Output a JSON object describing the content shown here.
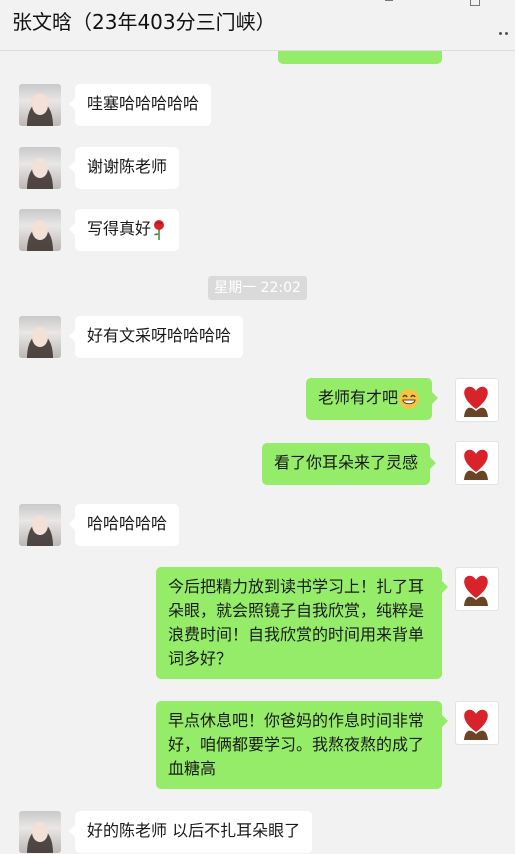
{
  "header": {
    "title": "张文晗（23年403分三门峡）"
  },
  "timestamp": "星期一 22:02",
  "messages": [
    {
      "side": "left",
      "text": "哇塞哈哈哈哈哈"
    },
    {
      "side": "left",
      "text": "谢谢陈老师"
    },
    {
      "side": "left",
      "text": "写得真好",
      "emoji": "rose-icon"
    },
    {
      "side": "left",
      "text": "好有文采呀哈哈哈哈"
    },
    {
      "side": "right",
      "text": "老师有才吧",
      "emoji": "grin-emoji-icon"
    },
    {
      "side": "right",
      "text": "看了你耳朵来了灵感"
    },
    {
      "side": "left",
      "text": "哈哈哈哈哈"
    },
    {
      "side": "right",
      "text": "今后把精力放到读书学习上！扎了耳朵眼，就会照镜子自我欣赏，纯粹是浪费时间！自我欣赏的时间用来背单词多好？"
    },
    {
      "side": "right",
      "text": "早点休息吧！你爸妈的作息时间非常好，咱俩都要学习。我熬夜熬的成了血糖高"
    },
    {
      "side": "left",
      "text": "好的陈老师 以后不扎耳朵眼了"
    }
  ],
  "colors": {
    "self_bubble": "#95ec69",
    "other_bubble": "#ffffff",
    "background": "#f2f2f2"
  }
}
